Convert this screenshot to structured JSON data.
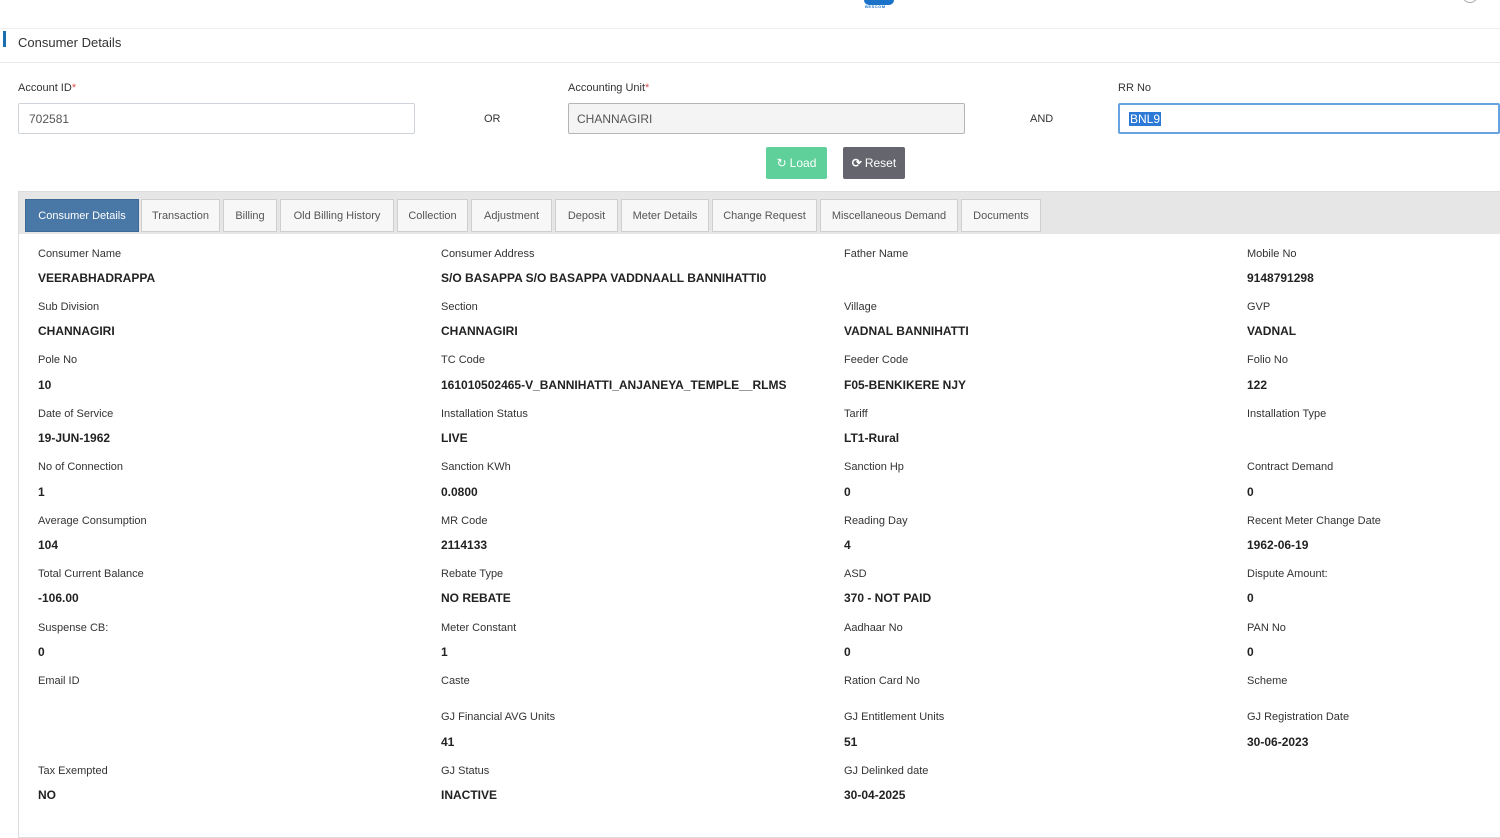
{
  "header": {
    "logo_text": "BESCOM"
  },
  "section": {
    "title": "Consumer Details"
  },
  "search": {
    "account_id_label": "Account ID",
    "account_id_value": "702581",
    "or_label": "OR",
    "accounting_unit_label": "Accounting Unit",
    "accounting_unit_value": "CHANNAGIRI",
    "and_label": "AND",
    "rr_no_label": "RR No",
    "rr_no_value": "BNL9",
    "required_mark": "*"
  },
  "buttons": {
    "load_label": "Load",
    "reset_label": "Reset"
  },
  "tabs": [
    {
      "label": "Consumer Details",
      "active": true
    },
    {
      "label": "Transaction"
    },
    {
      "label": "Billing"
    },
    {
      "label": "Old Billing History"
    },
    {
      "label": "Collection"
    },
    {
      "label": "Adjustment"
    },
    {
      "label": "Deposit"
    },
    {
      "label": "Meter Details"
    },
    {
      "label": "Change Request"
    },
    {
      "label": "Miscellaneous Demand"
    },
    {
      "label": "Documents"
    }
  ],
  "fields": {
    "consumer_name": {
      "label": "Consumer Name",
      "value": "VEERABHADRAPPA"
    },
    "consumer_address": {
      "label": "Consumer Address",
      "value": "S/O BASAPPA S/O BASAPPA VADDNAALL BANNIHATTI0"
    },
    "father_name": {
      "label": "Father Name",
      "value": ""
    },
    "mobile_no": {
      "label": "Mobile No",
      "value": "9148791298"
    },
    "sub_division": {
      "label": "Sub Division",
      "value": "CHANNAGIRI"
    },
    "section": {
      "label": "Section",
      "value": "CHANNAGIRI"
    },
    "village": {
      "label": "Village",
      "value": "VADNAL BANNIHATTI"
    },
    "gvp": {
      "label": "GVP",
      "value": "VADNAL"
    },
    "pole_no": {
      "label": "Pole No",
      "value": "10"
    },
    "tc_code": {
      "label": "TC Code",
      "value": "161010502465-V_BANNIHATTI_ANJANEYA_TEMPLE__RLMS"
    },
    "feeder_code": {
      "label": "Feeder Code",
      "value": "F05-BENKIKERE NJY"
    },
    "folio_no": {
      "label": "Folio No",
      "value": "122"
    },
    "date_of_service": {
      "label": "Date of Service",
      "value": "19-JUN-1962"
    },
    "installation_status": {
      "label": "Installation Status",
      "value": "LIVE"
    },
    "tariff": {
      "label": "Tariff",
      "value": "LT1-Rural"
    },
    "installation_type": {
      "label": "Installation Type",
      "value": ""
    },
    "no_of_connection": {
      "label": "No of Connection",
      "value": "1"
    },
    "sanction_kwh": {
      "label": "Sanction KWh",
      "value": "0.0800"
    },
    "sanction_hp": {
      "label": "Sanction Hp",
      "value": "0"
    },
    "contract_demand": {
      "label": "Contract Demand",
      "value": "0"
    },
    "average_consumption": {
      "label": "Average Consumption",
      "value": "104"
    },
    "mr_code": {
      "label": "MR Code",
      "value": "2114133"
    },
    "reading_day": {
      "label": "Reading Day",
      "value": "4"
    },
    "recent_meter_change_date": {
      "label": "Recent Meter Change Date",
      "value": "1962-06-19"
    },
    "total_current_balance": {
      "label": "Total Current Balance",
      "value": "-106.00"
    },
    "rebate_type": {
      "label": "Rebate Type",
      "value": "NO REBATE"
    },
    "asd": {
      "label": "ASD",
      "value": "370 - NOT PAID"
    },
    "dispute_amount": {
      "label": "Dispute Amount:",
      "value": "0"
    },
    "suspense_cb": {
      "label": "Suspense CB:",
      "value": "0"
    },
    "meter_constant": {
      "label": "Meter Constant",
      "value": "1"
    },
    "aadhaar_no": {
      "label": "Aadhaar No",
      "value": "0"
    },
    "pan_no": {
      "label": "PAN No",
      "value": "0"
    },
    "email_id": {
      "label": "Email ID",
      "value": ""
    },
    "caste": {
      "label": "Caste",
      "value": ""
    },
    "ration_card_no": {
      "label": "Ration Card No",
      "value": ""
    },
    "scheme": {
      "label": "Scheme",
      "value": ""
    },
    "gj_financial_avg_units": {
      "label": "GJ Financial AVG Units",
      "value": "41"
    },
    "gj_entitlement_units": {
      "label": "GJ Entitlement Units",
      "value": "51"
    },
    "gj_registration_date": {
      "label": "GJ Registration Date",
      "value": "30-06-2023"
    },
    "tax_exempted": {
      "label": "Tax Exempted",
      "value": "NO"
    },
    "gj_status": {
      "label": "GJ Status",
      "value": "INACTIVE"
    },
    "gj_delinked_date": {
      "label": "GJ Delinked date",
      "value": "30-04-2025"
    }
  },
  "colors": {
    "accent": "#1a6fb0",
    "load_button": "#5fd09a",
    "reset_button": "#65656d",
    "active_tab": "#4a78a6",
    "tab_bar": "#e6e6e6",
    "required": "#d9534f"
  }
}
